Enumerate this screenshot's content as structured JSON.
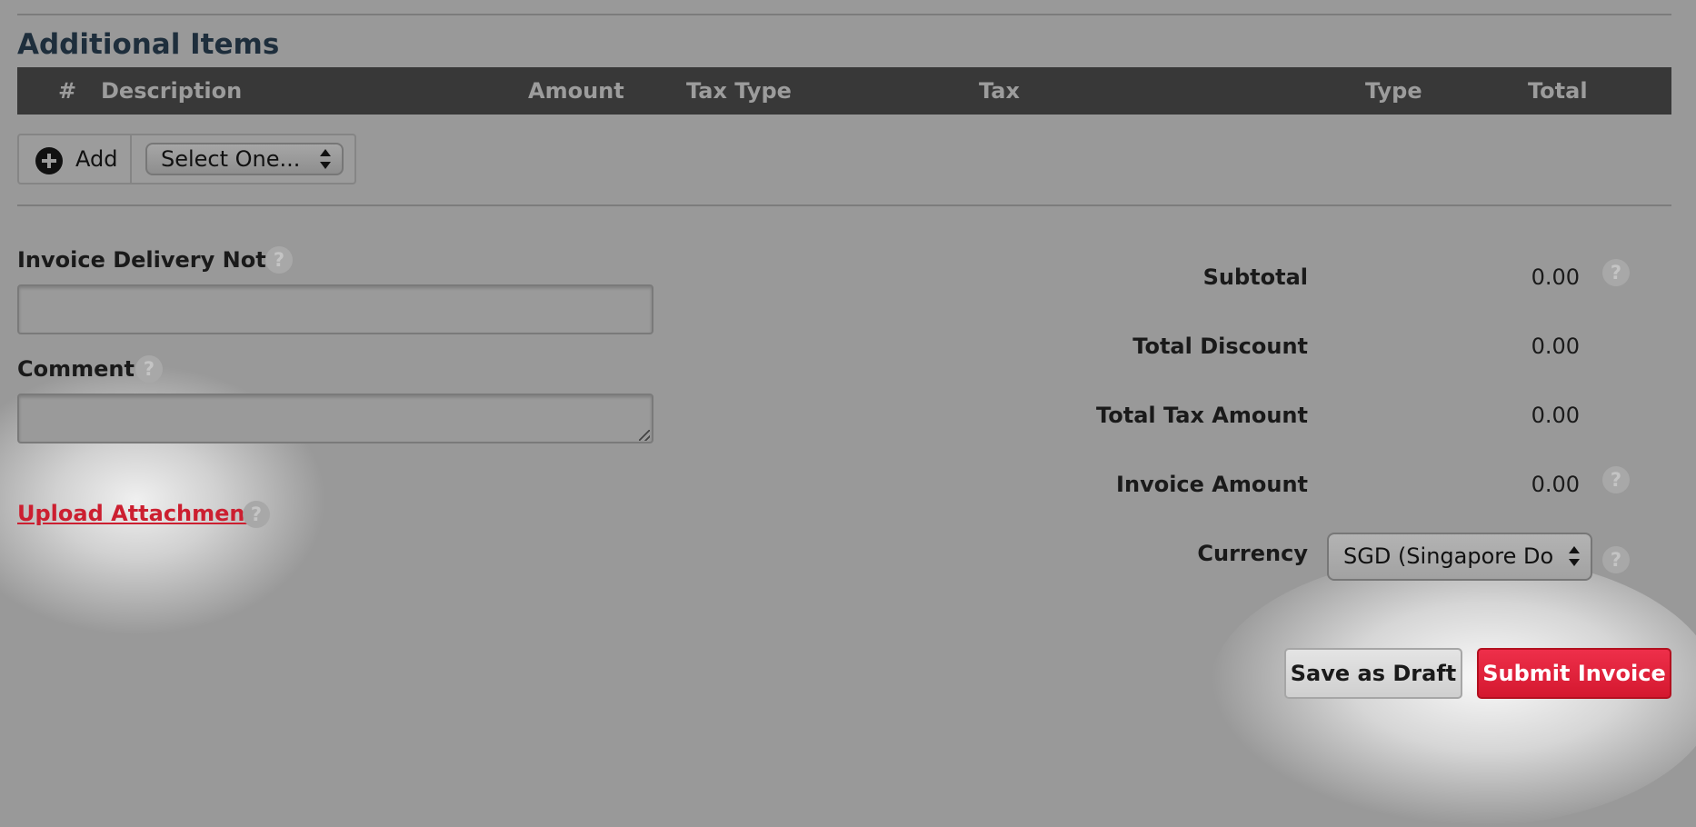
{
  "section": {
    "title": "Additional Items"
  },
  "table": {
    "columns": [
      "#",
      "Description",
      "Amount",
      "Tax Type",
      "Tax",
      "Type",
      "Total"
    ]
  },
  "add_row": {
    "add_label": "Add",
    "select_value": "Select One..."
  },
  "form": {
    "delivery_note_label": "Invoice Delivery Note",
    "delivery_note_value": "",
    "comment_label": "Comment",
    "comment_value": "",
    "upload_label": "Upload Attachment"
  },
  "summary": {
    "subtotal_label": "Subtotal",
    "subtotal_value": "0.00",
    "discount_label": "Total Discount",
    "discount_value": "0.00",
    "tax_label": "Total Tax Amount",
    "tax_value": "0.00",
    "invoice_label": "Invoice Amount",
    "invoice_value": "0.00",
    "currency_label": "Currency",
    "currency_value": "SGD (Singapore Dollar)"
  },
  "help_glyph": "?",
  "actions": {
    "draft_label": "Save as Draft",
    "submit_label": "Submit Invoice"
  },
  "colors": {
    "overlay": "#999999",
    "header_bar": "#383838",
    "link": "#cc1f30",
    "submit": "#d4182f"
  }
}
